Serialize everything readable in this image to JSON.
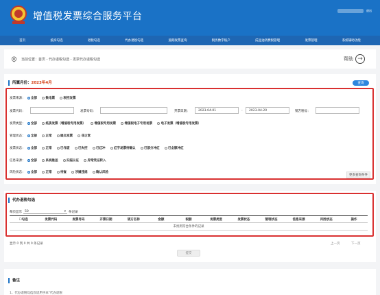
{
  "header": {
    "title": "增值税发票综合服务平台",
    "user_action": "退出"
  },
  "nav": [
    "首页",
    "抵扣勾选",
    "退税勾选",
    "代办退税勾选",
    "逾期发票查询",
    "税务数字账户",
    "成品油消费税管理",
    "发票管理",
    "系统辅助功能"
  ],
  "breadcrumb": {
    "text": "当前位置：首页 - 代办退税勾选 - 发票代办退税勾选",
    "help_label": "帮助"
  },
  "query": {
    "month_label": "所属月份：",
    "month_value": "2023年4月",
    "query_button": "查询",
    "source_label": "发票来源：",
    "source_options": [
      "全部",
      "数电票",
      "税控发票"
    ],
    "code_label": "发票代码：",
    "number_label": "发票号码：",
    "date_label": "开票日期：",
    "date_from": "2023-04-01",
    "date_sep": "-",
    "date_to": "2023-04-20",
    "seller_label": "销方税号：",
    "type_label": "发票类型：",
    "type_options": [
      "全部",
      "纸质发票（增值税专用发票）",
      "增值税专用发票",
      "增值税电子专用发票",
      "电子发票（增值税专用发票）"
    ],
    "mgmt_label": "管理状态：",
    "mgmt_options": [
      "全部",
      "正常",
      "疑点发票",
      "非正常"
    ],
    "status_label": "发票状态：",
    "status_options": [
      "全部",
      "正常",
      "已作废",
      "已失控",
      "已红冲",
      "红字发票待确认",
      "已部分冲红",
      "已全额冲红"
    ],
    "info_label": "信息来源：",
    "info_options": [
      "全部",
      "系统推送",
      "扫描认证",
      "异常凭证转入"
    ],
    "risk_label": "风险状态：",
    "risk_options": [
      "全部",
      "正常",
      "待查",
      "涉嫌违规",
      "确认风险"
    ],
    "more_label": "更多查询条件"
  },
  "list": {
    "title": "代办退税勾选",
    "page_show_prefix": "每页显示",
    "page_size": "50",
    "page_show_suffix": "条记录",
    "columns": [
      "勾选",
      "发票代码",
      "发票号码",
      "开票日期",
      "销方名称",
      "金额",
      "税额",
      "发票类型",
      "发票状态",
      "管理状态",
      "信息来源",
      "风险状态",
      "操作"
    ],
    "empty_text": "未找到符合条件的记录",
    "summary": "显示 0 到 0 共 0 条记录",
    "prev": "上一页",
    "next": "下一页",
    "submit": "提交"
  },
  "notes": {
    "title": "备注",
    "line1": "1、代办退税勾选仅适用于本\"代办退税"
  },
  "colors": {
    "header_blue": "#1a72c6",
    "nav_blue": "#1e66b3",
    "accent_red": "#d93030"
  }
}
